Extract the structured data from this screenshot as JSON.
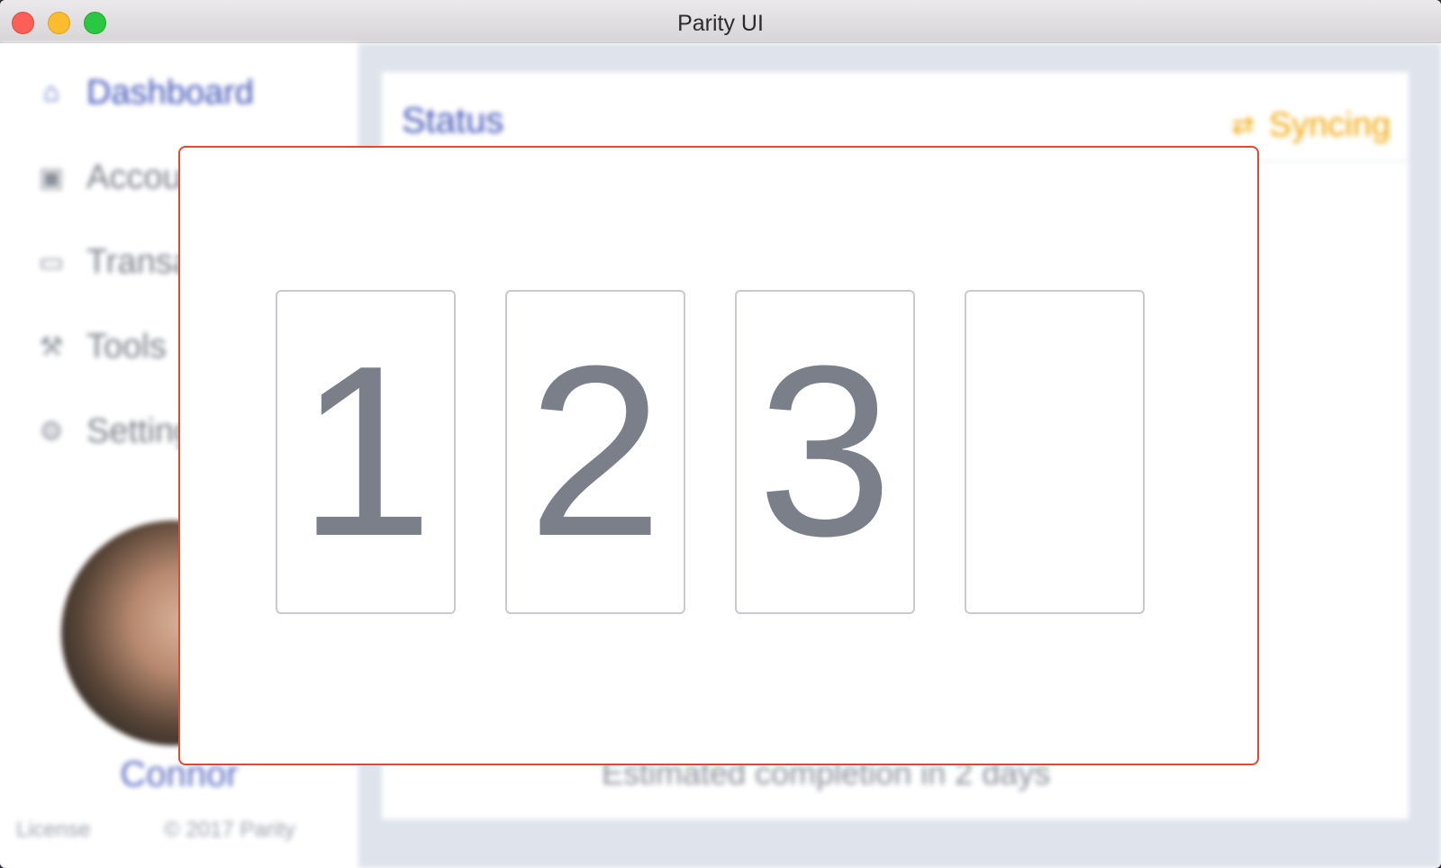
{
  "window": {
    "title": "Parity UI"
  },
  "sidebar": {
    "items": [
      {
        "label": "Dashboard",
        "icon": "home-icon",
        "active": true
      },
      {
        "label": "Accounts",
        "icon": "account-icon",
        "active": false
      },
      {
        "label": "Transactions",
        "icon": "card-icon",
        "active": false
      },
      {
        "label": "Tools",
        "icon": "wrench-icon",
        "active": false
      },
      {
        "label": "Settings",
        "icon": "gear-icon",
        "active": false
      }
    ],
    "username": "Connor",
    "footer": {
      "license": "License",
      "copyright": "© 2017 Parity"
    }
  },
  "main": {
    "card_title": "Status",
    "sync_status": "Syncing",
    "estimate_text": "Estimated completion in 2 days"
  },
  "pin_modal": {
    "digits": [
      "1",
      "2",
      "3",
      ""
    ]
  },
  "colors": {
    "accent": "#3f51b5",
    "sync": "#f0a500",
    "modal_border": "#e04a2f"
  }
}
